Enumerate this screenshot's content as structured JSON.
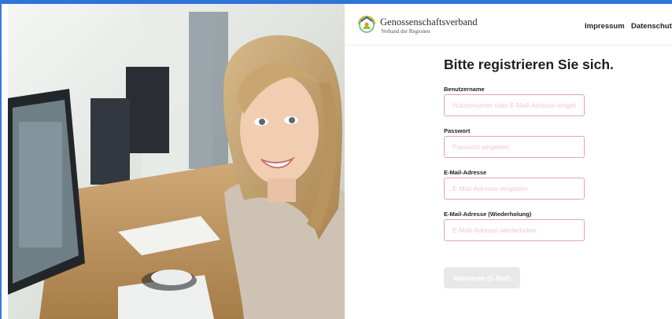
{
  "header": {
    "brand_name": "Genossenschaftsverband",
    "brand_sub": "Verband der Regionen",
    "nav": [
      {
        "label": "Impressum"
      },
      {
        "label": "Datenschutz"
      }
    ]
  },
  "form": {
    "title": "Bitte registrieren Sie sich.",
    "fields": [
      {
        "label": "Benutzername",
        "placeholder": "Nutzernamen oder E-Mail-Adresse eingeben",
        "value": ""
      },
      {
        "label": "Passwort",
        "placeholder": "Passwort eingeben",
        "value": ""
      },
      {
        "label": "E-Mail-Adresse",
        "placeholder": "E-Mail-Adresse eingeben",
        "value": ""
      },
      {
        "label": "E-Mail-Adresse (Wiederholung)",
        "placeholder": "E-Mail-Adresse wiederholen",
        "value": ""
      }
    ],
    "submit_label": "Aktivieren (E-Mail)"
  },
  "colors": {
    "accent_border": "#e6a3aa",
    "frame_blue": "#2f73d6",
    "button_disabled": "#e8e8e8"
  },
  "icons": [
    "genossenschaftsverband-logo-icon"
  ]
}
